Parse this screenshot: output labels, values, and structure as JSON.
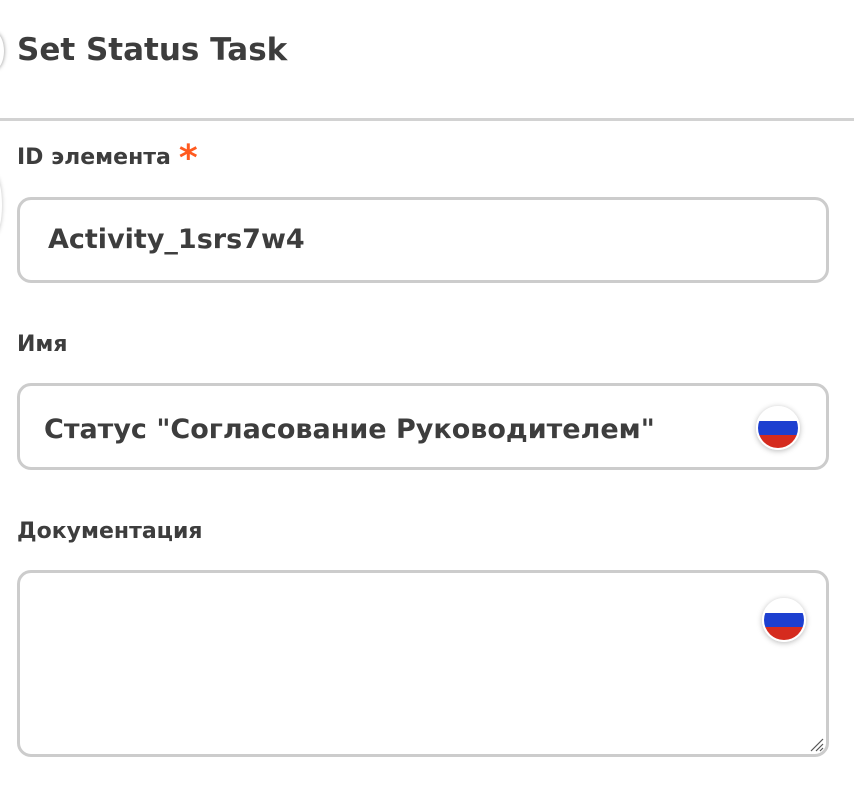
{
  "panel": {
    "title": "Set Status Task"
  },
  "fields": {
    "element_id": {
      "label": "ID элемента",
      "required_mark": "*",
      "value": "Activity_1srs7w4"
    },
    "name": {
      "label": "Имя",
      "value": "Статус \"Согласование Руководителем\"",
      "language_icon": "russia-flag-icon"
    },
    "documentation": {
      "label": "Документация",
      "value": "",
      "language_icon": "russia-flag-icon"
    }
  },
  "colors": {
    "text": "#3d3d3d",
    "required": "#ff5a1f",
    "border": "#cccccc",
    "divider": "#d2d2d2"
  }
}
